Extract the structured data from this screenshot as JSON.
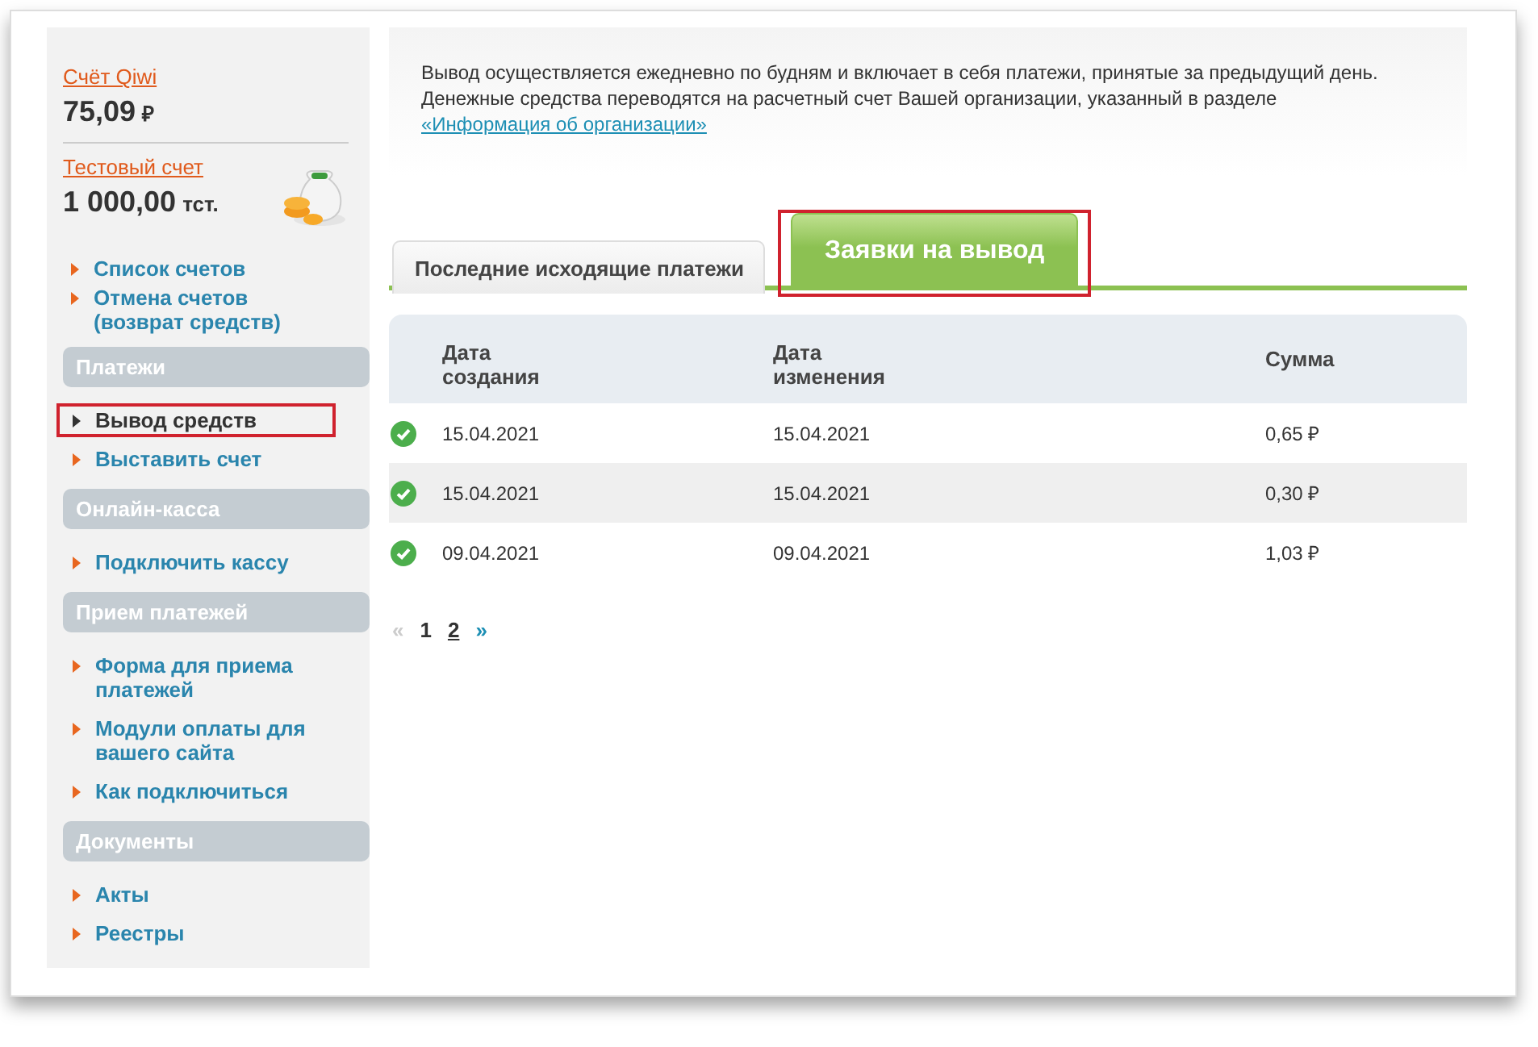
{
  "accounts": [
    {
      "label": "Счёт Qiwi",
      "amount": "75,09",
      "currency": "₽",
      "icon": false
    },
    {
      "label": "Тестовый счет",
      "amount": "1 000,00",
      "currency": "тст.",
      "icon": true
    }
  ],
  "account_links": [
    {
      "label": "Список счетов"
    },
    {
      "label": "Отмена счетов (возврат средств)"
    }
  ],
  "sections": [
    {
      "title": "Платежи",
      "items": [
        {
          "label": "Вывод средств",
          "selected": true,
          "highlighted": true
        },
        {
          "label": "Выставить счет",
          "selected": false,
          "highlighted": false
        }
      ]
    },
    {
      "title": "Онлайн-касса",
      "items": [
        {
          "label": "Подключить кассу",
          "selected": false,
          "highlighted": false
        }
      ]
    },
    {
      "title": "Прием платежей",
      "items": [
        {
          "label": "Форма для приема платежей",
          "selected": false,
          "highlighted": false
        },
        {
          "label": "Модули оплаты для вашего сайта",
          "selected": false,
          "highlighted": false
        },
        {
          "label": "Как подключиться",
          "selected": false,
          "highlighted": false
        }
      ]
    },
    {
      "title": "Документы",
      "items": [
        {
          "label": "Акты",
          "selected": false,
          "highlighted": false
        },
        {
          "label": "Реестры",
          "selected": false,
          "highlighted": false
        }
      ]
    }
  ],
  "info": {
    "text": "Вывод осуществляется ежедневно по будням и включает в себя платежи, принятые за предыдущий день. Денежные средства переводятся на расчетный счет Вашей организации, указанный в разделе",
    "link": "«Информация об организации»"
  },
  "tabs": [
    {
      "label": "Последние исходящие платежи",
      "selected": false,
      "highlighted": false
    },
    {
      "label": "Заявки на вывод",
      "selected": true,
      "highlighted": true
    }
  ],
  "table": {
    "columns": [
      "Дата создания",
      "Дата изменения",
      "Сумма"
    ],
    "rows": [
      {
        "done": true,
        "created": "15.04.2021",
        "changed": "15.04.2021",
        "amount": "0,65 ₽"
      },
      {
        "done": true,
        "created": "15.04.2021",
        "changed": "15.04.2021",
        "amount": "0,30 ₽"
      },
      {
        "done": true,
        "created": "09.04.2021",
        "changed": "09.04.2021",
        "amount": "1,03 ₽"
      }
    ]
  },
  "pagination": {
    "prev": {
      "label": "«",
      "disabled": true
    },
    "pages": [
      {
        "label": "1",
        "selected": true
      },
      {
        "label": "2",
        "selected": false
      }
    ],
    "next": {
      "label": "»",
      "disabled": false
    }
  }
}
